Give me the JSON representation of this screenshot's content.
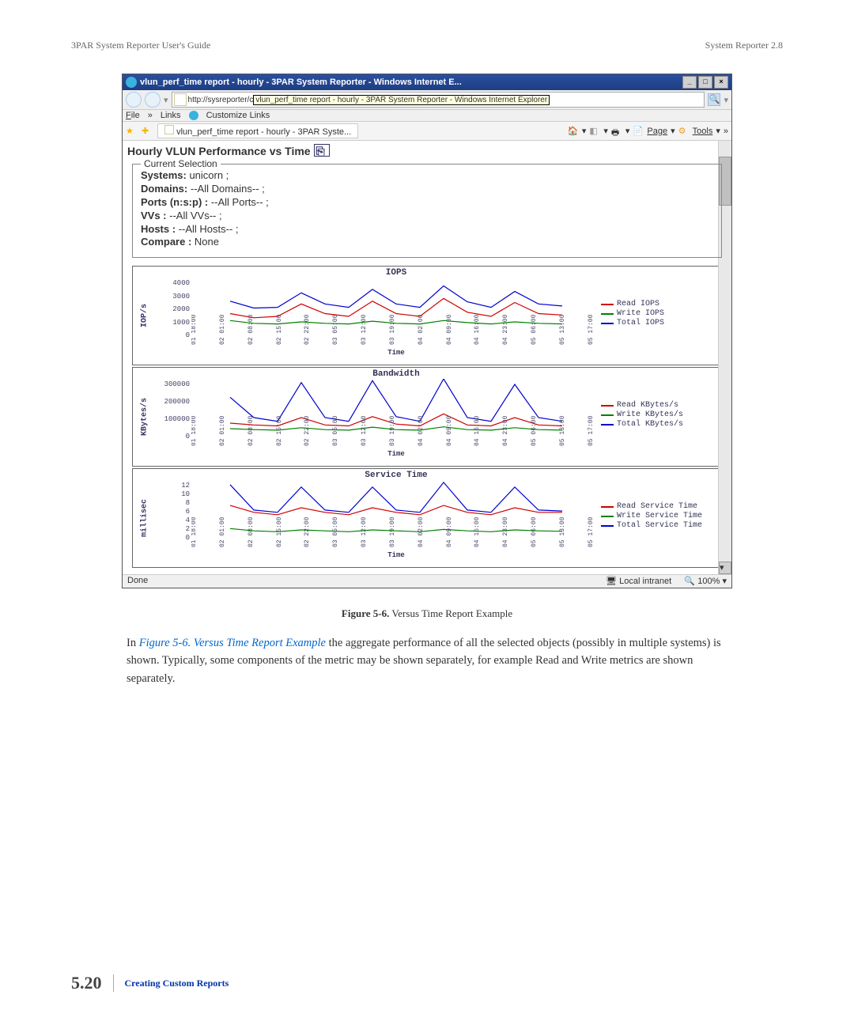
{
  "header": {
    "left": "3PAR System Reporter User's Guide",
    "right": "System Reporter 2.8"
  },
  "ie": {
    "title": "vlun_perf_time report - hourly - 3PAR System Reporter - Windows Internet E...",
    "address_prefix": "http://sysreporter/c",
    "tooltip": "vlun_perf_time report - hourly - 3PAR System Reporter - Windows Internet Explorer",
    "file_menu": "File",
    "links_label": "Links",
    "customize_links": "Customize Links",
    "tab_label": "vlun_perf_time report - hourly - 3PAR Syste...",
    "page_btn": "Page",
    "tools_btn": "Tools",
    "status_done": "Done",
    "status_zone": "Local intranet",
    "status_zoom": "100%"
  },
  "report": {
    "title": "Hourly VLUN Performance vs Time",
    "legend": "Current Selection",
    "systems_label": "Systems:",
    "systems": "unicorn ;",
    "domains_label": "Domains:",
    "domains": "--All Domains-- ;",
    "ports_label": "Ports (n:s:p) :",
    "ports": "--All Ports-- ;",
    "vvs_label": "VVs :",
    "vvs": "--All VVs-- ;",
    "hosts_label": "Hosts :",
    "hosts": "--All Hosts-- ;",
    "compare_label": "Compare :",
    "compare": "None"
  },
  "chart_data": [
    {
      "type": "line",
      "title": "IOPS",
      "ylabel": "IOP/s",
      "xlabel": "Time",
      "ylim": [
        0,
        4000
      ],
      "yticks": [
        0,
        1000,
        2000,
        3000,
        4000
      ],
      "categories": [
        "01 18:00",
        "02 01:00",
        "02 08:00",
        "02 15:00",
        "02 22:00",
        "03 05:00",
        "03 12:00",
        "03 19:00",
        "04 02:00",
        "04 09:00",
        "04 16:00",
        "04 23:00",
        "05 06:00",
        "05 13:00",
        "05 17:00"
      ],
      "series": [
        {
          "name": "Read IOPS",
          "color": "#d00000",
          "values": [
            1400,
            1100,
            1200,
            2100,
            1400,
            1200,
            2300,
            1400,
            1200,
            2500,
            1500,
            1200,
            2200,
            1400,
            1300
          ]
        },
        {
          "name": "Write IOPS",
          "color": "#008000",
          "values": [
            900,
            700,
            650,
            800,
            700,
            650,
            850,
            700,
            650,
            900,
            750,
            650,
            800,
            700,
            650
          ]
        },
        {
          "name": "Total IOPS",
          "color": "#0000d0",
          "values": [
            2300,
            1800,
            1850,
            2900,
            2100,
            1850,
            3150,
            2100,
            1850,
            3400,
            2250,
            1850,
            3000,
            2100,
            1950
          ]
        }
      ]
    },
    {
      "type": "line",
      "title": "Bandwidth",
      "ylabel": "KBytes/s",
      "xlabel": "Time",
      "ylim": [
        0,
        300000
      ],
      "yticks": [
        0,
        100000,
        200000,
        300000
      ],
      "categories": [
        "01 18:00",
        "02 01:00",
        "02 08:00",
        "02 15:00",
        "02 22:00",
        "03 05:00",
        "03 12:00",
        "03 19:00",
        "04 02:00",
        "04 09:00",
        "04 16:00",
        "04 23:00",
        "05 06:00",
        "05 13:00",
        "05 17:00"
      ],
      "series": [
        {
          "name": "Read KBytes/s",
          "color": "#d00000",
          "values": [
            60000,
            50000,
            45000,
            90000,
            50000,
            45000,
            95000,
            55000,
            45000,
            110000,
            50000,
            45000,
            90000,
            50000,
            45000
          ]
        },
        {
          "name": "Write KBytes/s",
          "color": "#008000",
          "values": [
            30000,
            25000,
            22000,
            35000,
            25000,
            22000,
            38000,
            25000,
            22000,
            40000,
            25000,
            22000,
            35000,
            25000,
            22000
          ]
        },
        {
          "name": "Total KBytes/s",
          "color": "#0000d0",
          "values": [
            200000,
            90000,
            70000,
            280000,
            90000,
            70000,
            290000,
            95000,
            70000,
            300000,
            90000,
            70000,
            270000,
            90000,
            70000
          ]
        }
      ]
    },
    {
      "type": "line",
      "title": "Service Time",
      "ylabel": "millisec",
      "xlabel": "Time",
      "ylim": [
        0,
        12
      ],
      "yticks": [
        0,
        2,
        4,
        6,
        8,
        10,
        12
      ],
      "categories": [
        "01 18:00",
        "02 01:00",
        "02 08:00",
        "02 15:00",
        "02 22:00",
        "03 05:00",
        "03 12:00",
        "03 19:00",
        "04 02:00",
        "04 09:00",
        "04 16:00",
        "04 23:00",
        "05 06:00",
        "05 13:00",
        "05 17:00"
      ],
      "series": [
        {
          "name": "Read Service Time",
          "color": "#d00000",
          "values": [
            6.5,
            5.0,
            4.5,
            6.0,
            5.0,
            4.5,
            6.0,
            5.0,
            4.5,
            6.5,
            5.0,
            4.5,
            6.0,
            5.0,
            5.0
          ]
        },
        {
          "name": "Write Service Time",
          "color": "#008000",
          "values": [
            1.5,
            1.0,
            0.8,
            1.2,
            1.0,
            0.8,
            1.2,
            1.0,
            0.8,
            1.3,
            1.0,
            0.8,
            1.2,
            1.0,
            0.9
          ]
        },
        {
          "name": "Total Service Time",
          "color": "#0000d0",
          "values": [
            11.0,
            5.5,
            5.0,
            10.5,
            5.5,
            5.0,
            10.5,
            5.5,
            5.0,
            11.5,
            5.5,
            5.0,
            10.5,
            5.5,
            5.3
          ]
        }
      ]
    }
  ],
  "caption": {
    "label": "Figure 5-6.",
    "text": "Versus Time Report Example"
  },
  "body": {
    "pre": "In ",
    "link": "Figure 5-6. Versus Time Report Example",
    "post": " the aggregate performance of all the selected objects (possibly in multiple systems) is shown. Typically, some components of the metric may be shown separately, for example Read and Write metrics are shown separately."
  },
  "footer": {
    "page": "5.20",
    "section": "Creating Custom Reports"
  }
}
